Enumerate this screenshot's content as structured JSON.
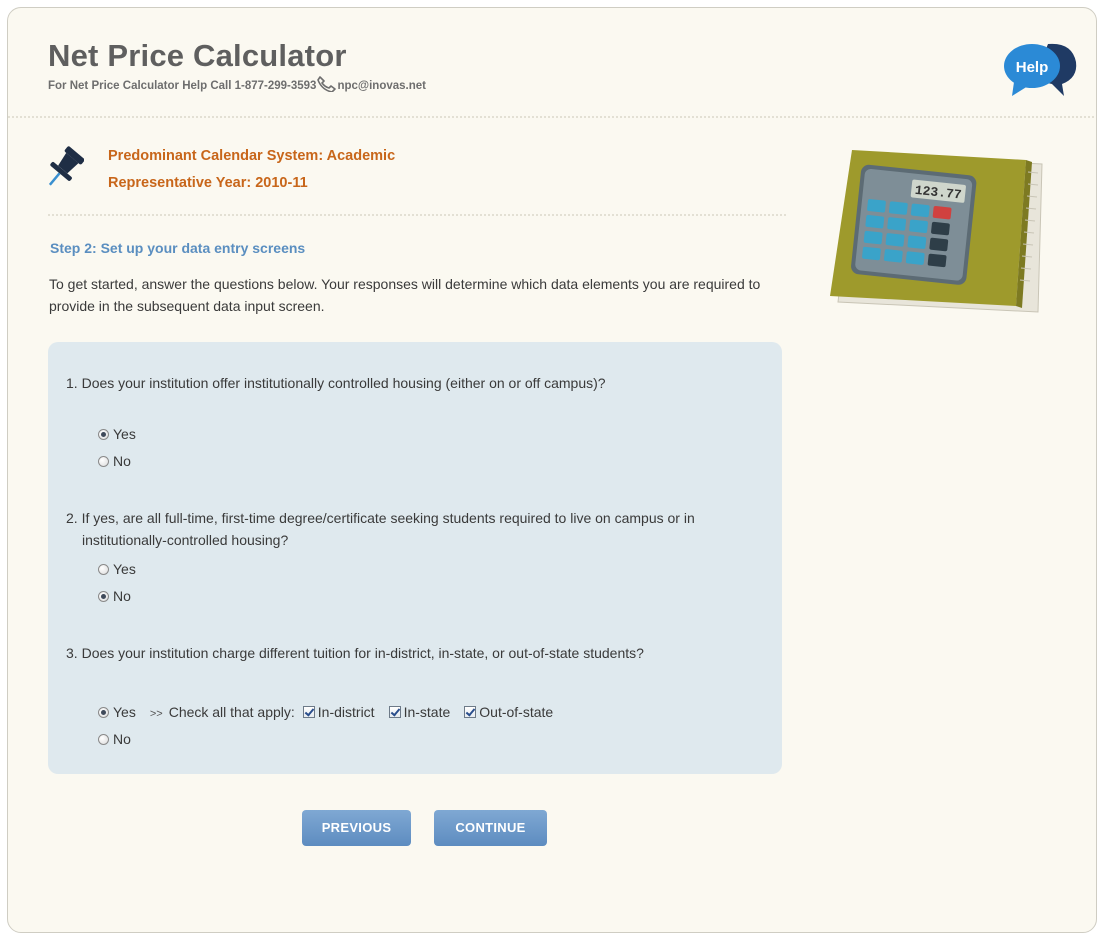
{
  "header": {
    "title": "Net Price Calculator",
    "help_text": "For Net Price Calculator Help Call 1-877-299-3593",
    "email": "npc@inovas.net",
    "help_bubble_label": "Help"
  },
  "calendar": {
    "system": "Predominant Calendar System: Academic",
    "year": "Representative Year: 2010-11"
  },
  "step": {
    "title": "Step 2: Set up your data entry screens",
    "intro": "To get started, answer the questions below. Your responses will determine which data elements you are required to provide in the subsequent data input screen."
  },
  "questions": [
    {
      "number": "1.",
      "text": "Does your institution offer institutionally controlled housing (either on or off campus)?",
      "yes_label": "Yes",
      "no_label": "No",
      "selected": "Yes"
    },
    {
      "number": "2.",
      "text": "If yes, are all full-time, first-time degree/certificate seeking students required to live on campus or in institutionally-controlled housing?",
      "yes_label": "Yes",
      "no_label": "No",
      "selected": "No"
    },
    {
      "number": "3.",
      "text": "Does your institution charge different tuition for in-district, in-state, or out-of-state students?",
      "yes_label": "Yes",
      "no_label": "No",
      "selected": "Yes",
      "arrow": ">>",
      "check_prompt": "Check all that apply:",
      "checks": [
        {
          "label": "In-district",
          "checked": true
        },
        {
          "label": "In-state",
          "checked": true
        },
        {
          "label": "Out-of-state",
          "checked": true
        }
      ]
    }
  ],
  "buttons": {
    "previous": "PREVIOUS",
    "continue": "CONTINUE"
  },
  "calculator_display": "123.77",
  "colors": {
    "background": "#fbf9f1",
    "calendar_text": "#c8661a",
    "step_title": "#5a8ec0",
    "panel": "#dfe9ee",
    "button": "#6a97c8",
    "help_bubble": "#2b8ad6"
  }
}
